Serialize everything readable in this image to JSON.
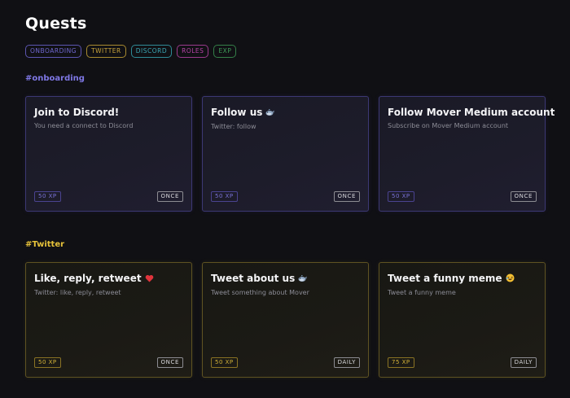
{
  "page": {
    "title": "Quests"
  },
  "filters": [
    {
      "label": "ONBOARDING",
      "color": "#6f67d0"
    },
    {
      "label": "TWITTER",
      "color": "#c9a43a"
    },
    {
      "label": "DISCORD",
      "color": "#3aa7b5"
    },
    {
      "label": "ROLES",
      "color": "#b944a8"
    },
    {
      "label": "EXP",
      "color": "#3f9c58"
    }
  ],
  "sections": {
    "onboarding": {
      "label": "#onboarding",
      "color": "#7f78e6",
      "cards": [
        {
          "title": "Join to Discord!",
          "description": "You need a connect to Discord",
          "xp": "50 XP",
          "frequency": "ONCE"
        },
        {
          "title": "Follow us",
          "title_icon": "whale-emoji-icon",
          "description": "Twitter: follow",
          "xp": "50 XP",
          "frequency": "ONCE"
        },
        {
          "title": "Follow Mover Medium account",
          "description": "Subscribe on Mover Medium account",
          "xp": "50 XP",
          "frequency": "ONCE"
        }
      ]
    },
    "twitter": {
      "label": "#Twitter",
      "color": "#e6c23a",
      "cards": [
        {
          "title": "Like, reply, retweet",
          "title_icon": "heart-emoji-icon",
          "description": "Twitter: like, reply, retweet",
          "xp": "50 XP",
          "frequency": "ONCE"
        },
        {
          "title": "Tweet about us",
          "title_icon": "whale-emoji-icon",
          "description": "Tweet something about Mover",
          "xp": "50 XP",
          "frequency": "DAILY"
        },
        {
          "title": "Tweet a funny meme",
          "title_icon": "laughing-emoji-icon",
          "description": "Tweet a funny meme",
          "xp": "75 XP",
          "frequency": "DAILY"
        }
      ]
    }
  }
}
